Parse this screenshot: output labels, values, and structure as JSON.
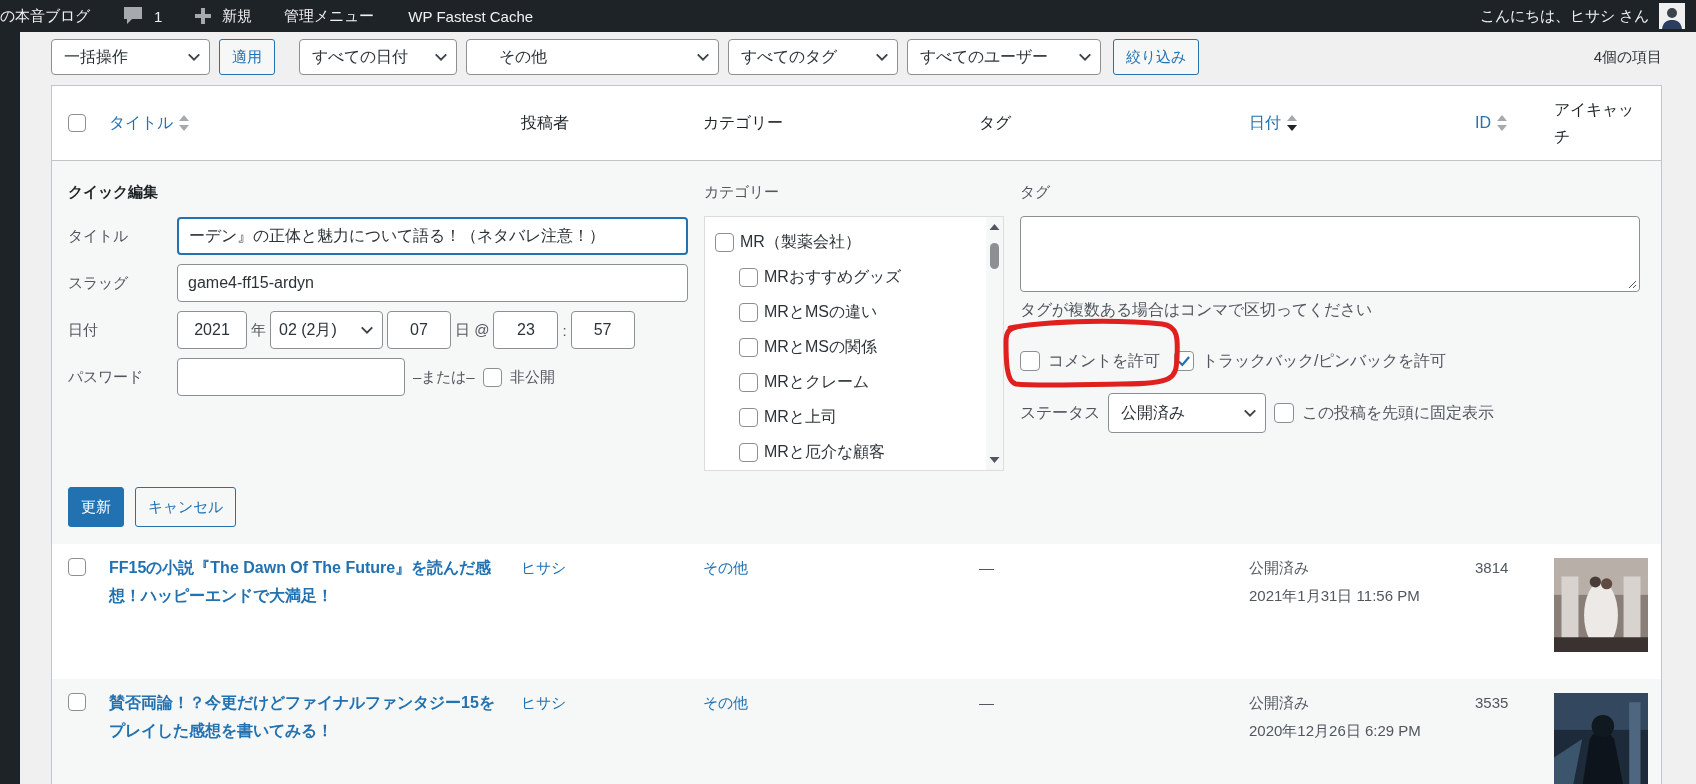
{
  "admin_bar": {
    "site_title": "の本音ブログ",
    "comment_count": "1",
    "new_label": "新規",
    "menu_items": [
      "管理メニュー",
      "WP Fastest Cache"
    ],
    "greeting": "こんにちは、ヒサシ さん"
  },
  "tablenav": {
    "bulk_action": "一括操作",
    "apply_button": "適用",
    "filters": [
      {
        "label": "すべての日付",
        "indented": false
      },
      {
        "label": "その他",
        "indented": true
      },
      {
        "label": "すべてのタグ",
        "indented": false
      },
      {
        "label": "すべてのユーザー",
        "indented": false
      }
    ],
    "filter_button": "絞り込み",
    "item_count": "4個の項目"
  },
  "table": {
    "select_all_checked": false,
    "columns": [
      {
        "label": "タイトル",
        "sortable": true,
        "sorted": false
      },
      {
        "label": "投稿者",
        "sortable": false
      },
      {
        "label": "カテゴリー",
        "sortable": false
      },
      {
        "label": "タグ",
        "sortable": false
      },
      {
        "label": "日付",
        "sortable": true,
        "sorted": true
      },
      {
        "label": "ID",
        "sortable": true,
        "sorted": false
      },
      {
        "label": "アイキャッチ",
        "sortable": false
      }
    ],
    "quick_edit": {
      "heading": "クイック編集",
      "title_label": "タイトル",
      "title_value": "ーデン』の正体と魅力について語る！（ネタバレ注意！）",
      "slug_label": "スラッグ",
      "slug_value": "game4-ff15-ardyn",
      "date": {
        "label": "日付",
        "year": "2021",
        "year_unit": "年",
        "month": "02 (2月)",
        "day": "07",
        "day_unit": "日 @",
        "hour": "23",
        "separator": ":",
        "minute": "57"
      },
      "password": {
        "label": "パスワード",
        "or_text": "–または–",
        "private_label": "非公開",
        "private_checked": false
      },
      "category_heading": "カテゴリー",
      "categories": [
        {
          "label": "MR（製薬会社）",
          "checked": false,
          "children": [
            {
              "label": "MRおすすめグッズ",
              "checked": false
            },
            {
              "label": "MRとMSの違い",
              "checked": false
            },
            {
              "label": "MRとMSの関係",
              "checked": false
            },
            {
              "label": "MRとクレーム",
              "checked": false
            },
            {
              "label": "MRと上司",
              "checked": false
            },
            {
              "label": "MRと厄介な顧客",
              "checked": false
            }
          ]
        }
      ],
      "tag_heading": "タグ",
      "tag_hint": "タグが複数ある場合はコンマで区切ってください",
      "options": [
        {
          "label": "コメントを許可",
          "checked": false
        },
        {
          "label": "トラックバック/ピンバックを許可",
          "checked": true
        }
      ],
      "status_label": "ステータス",
      "status_value": "公開済み",
      "sticky": {
        "label": "この投稿を先頭に固定表示",
        "checked": false
      },
      "update_button": "更新",
      "cancel_button": "キャンセル"
    },
    "rows": [
      {
        "checked": false,
        "title": "FF15の小説『The Dawn Of The Future』を読んだ感想！ハッピーエンドで大満足！",
        "author": "ヒサシ",
        "category": "その他",
        "tags": "—",
        "status": "公開済み",
        "date": "2021年1月31日 11:56 PM",
        "id": "3814"
      },
      {
        "checked": false,
        "title": "賛否両論！？今更だけどファイナルファンタジー15をプレイした感想を書いてみる！",
        "author": "ヒサシ",
        "category": "その他",
        "tags": "—",
        "status": "公開済み",
        "date": "2020年12月26日 6:29 PM",
        "id": "3535"
      }
    ]
  }
}
